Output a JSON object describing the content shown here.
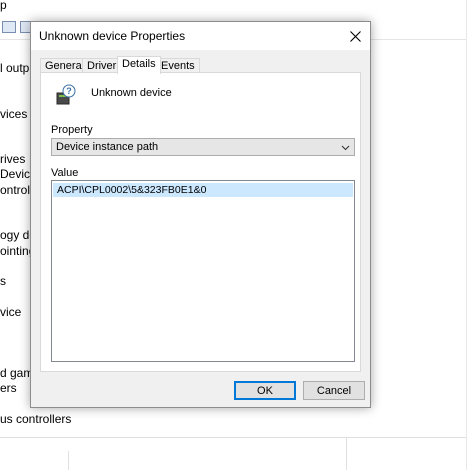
{
  "background": {
    "menu_fragment": "p",
    "tree_items": [
      "l outpu",
      "vices",
      "rives",
      "Device",
      "ontrolle",
      "ogy de",
      "ointing",
      "s",
      "vice",
      "d game",
      "ers",
      "us controllers"
    ]
  },
  "dialog": {
    "title": "Unknown device Properties",
    "tabs": [
      {
        "label": "General"
      },
      {
        "label": "Driver"
      },
      {
        "label": "Details"
      },
      {
        "label": "Events"
      }
    ],
    "active_tab": "Details",
    "device_name": "Unknown device",
    "property_label": "Property",
    "property_selected": "Device instance path",
    "value_label": "Value",
    "values": [
      "ACPI\\CPL0002\\5&323FB0E1&0"
    ],
    "ok_label": "OK",
    "cancel_label": "Cancel"
  },
  "colors": {
    "selection": "#cce8ff",
    "accent": "#0078d7",
    "dialog_bg": "#f0f0f0"
  }
}
